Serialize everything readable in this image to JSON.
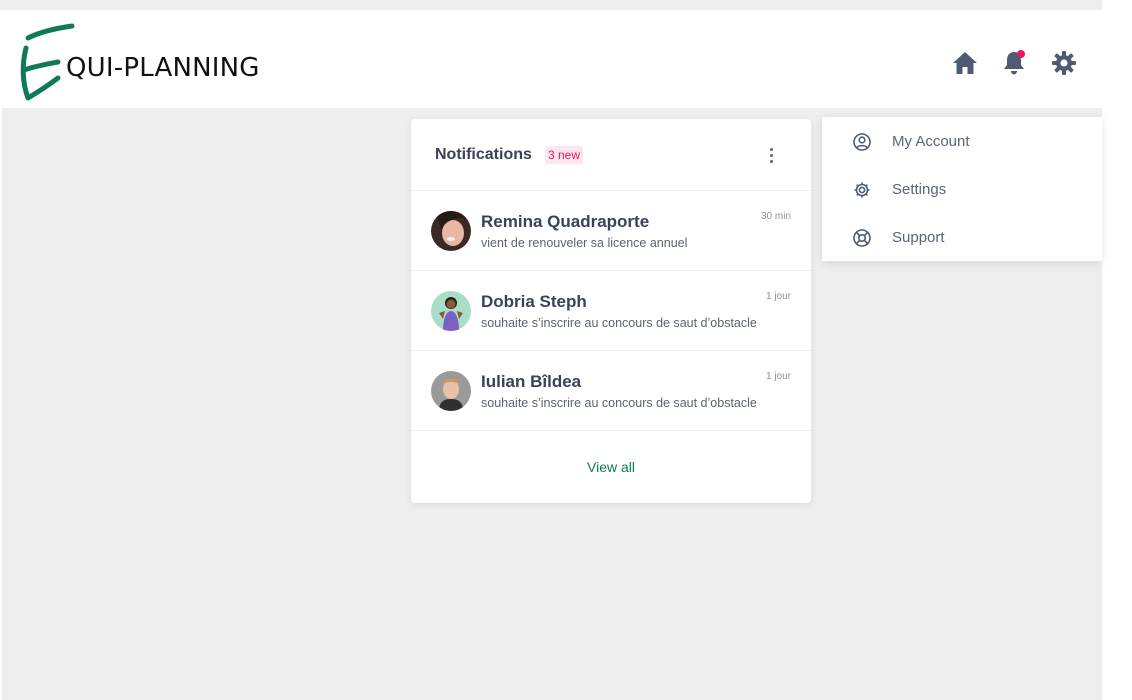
{
  "brand": {
    "logo_letter": "E",
    "logo_text": "QUI-PLANNING",
    "accent_color": "#0f7a5a"
  },
  "header": {
    "icons": [
      "home-icon",
      "bell-icon",
      "gear-icon"
    ],
    "notification_dot_color": "#e8175d"
  },
  "notifications": {
    "title": "Notifications",
    "new_badge": "3 new",
    "items": [
      {
        "name": "Remina Quadraporte",
        "text": "vient de renouveler sa licence annuel",
        "time": "30 min"
      },
      {
        "name": "Dobria Steph",
        "text": "souhaite s’inscrire au concours de saut d’obstacle",
        "time": "1 jour"
      },
      {
        "name": "Iulian Bîldea",
        "text": "souhaite s’inscrire au concours de saut d’obstacle",
        "time": "1 jour"
      }
    ],
    "view_all": "View all"
  },
  "account_menu": {
    "items": [
      {
        "label": "My Account",
        "icon": "user-circle-icon"
      },
      {
        "label": "Settings",
        "icon": "gear-icon"
      },
      {
        "label": "Support",
        "icon": "lifebuoy-icon"
      }
    ]
  }
}
